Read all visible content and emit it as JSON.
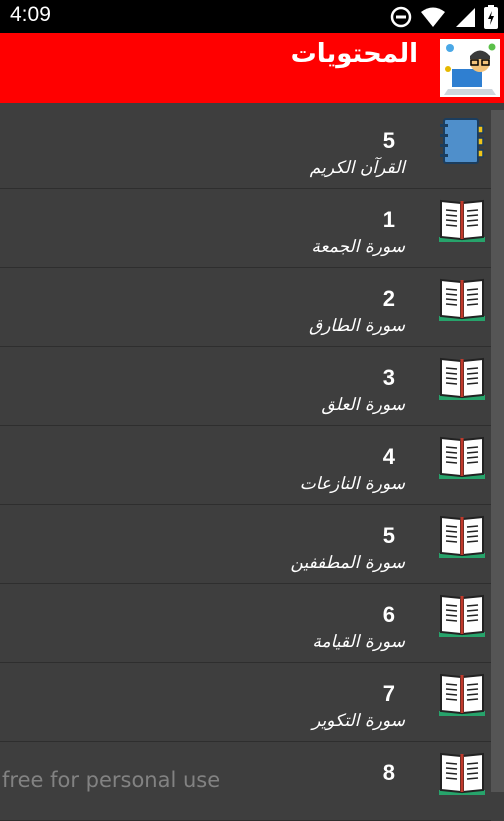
{
  "status": {
    "time": "4:09"
  },
  "app": {
    "title": "المحتويات"
  },
  "items": [
    {
      "num": "5",
      "title": "القرآن الكريم",
      "icon": "notebook-icon"
    },
    {
      "num": "1",
      "title": "سورة الجمعة",
      "icon": "book-icon"
    },
    {
      "num": "2",
      "title": "سورة الطارق",
      "icon": "book-icon"
    },
    {
      "num": "3",
      "title": "سورة العلق",
      "icon": "book-icon"
    },
    {
      "num": "4",
      "title": "سورة النازعات",
      "icon": "book-icon"
    },
    {
      "num": "5",
      "title": "سورة المطففين",
      "icon": "book-icon"
    },
    {
      "num": "6",
      "title": "سورة القيامة",
      "icon": "book-icon"
    },
    {
      "num": "7",
      "title": "سورة التكوير",
      "icon": "book-icon"
    },
    {
      "num": "8",
      "title": "",
      "icon": "book-icon"
    }
  ],
  "watermark": "free for personal use"
}
